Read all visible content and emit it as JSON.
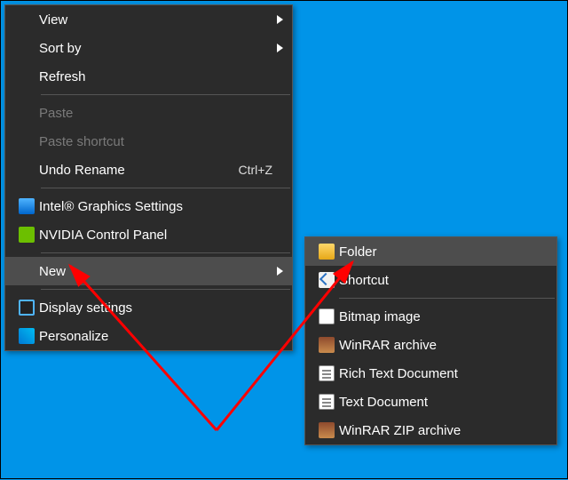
{
  "main": {
    "view": "View",
    "sortby": "Sort by",
    "refresh": "Refresh",
    "paste": "Paste",
    "paste_shortcut": "Paste shortcut",
    "undo": "Undo Rename",
    "undo_key": "Ctrl+Z",
    "intel": "Intel® Graphics Settings",
    "nvidia": "NVIDIA Control Panel",
    "new": "New",
    "display": "Display settings",
    "personalize": "Personalize"
  },
  "sub": {
    "folder": "Folder",
    "shortcut": "Shortcut",
    "bmp": "Bitmap image",
    "rar": "WinRAR archive",
    "rtf": "Rich Text Document",
    "txt": "Text Document",
    "zip": "WinRAR ZIP archive"
  }
}
